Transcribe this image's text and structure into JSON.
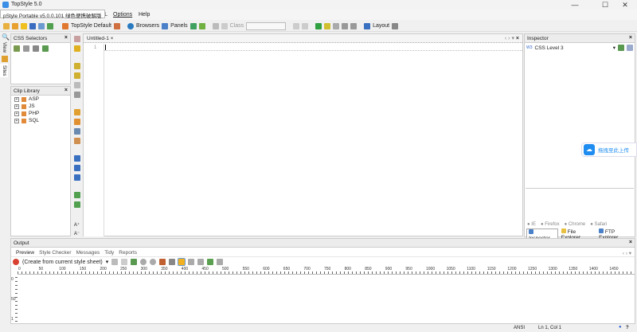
{
  "window": {
    "title": "TopStyle 5.0",
    "tooltip": "pStyle Portable v5.0.0.101 绿色便携破解版",
    "minimize": "—",
    "maximize": "☐",
    "close": "✕"
  },
  "menu": [
    "TML",
    "Options",
    "Help"
  ],
  "toolbar": {
    "style": "TopStyle Default",
    "browsers": "Browsers",
    "panels": "Panels",
    "class_label": "Class",
    "class_value": "",
    "layout": "Layout"
  },
  "left_tabs": [
    "View",
    "Sites"
  ],
  "css_selectors": {
    "title": "CSS Selectors"
  },
  "clip_library": {
    "title": "Clip Library",
    "items": [
      "ASP",
      "JS",
      "PHP",
      "SQL"
    ]
  },
  "editor": {
    "tab": "Untitled-1",
    "line": "1"
  },
  "inspector": {
    "title": "Inspector",
    "level": "CSS Level 3",
    "browsers": [
      "IE",
      "Firefox",
      "Chrome",
      "Safari"
    ],
    "tabs": [
      "Inspector",
      "File Explorer",
      "FTP Explorer"
    ],
    "upload": "拖拽至此上传",
    "upload_color": "#1e8cf0"
  },
  "output": {
    "title": "Output",
    "tabs": [
      "Preview",
      "Style Checker",
      "Messages",
      "Tidy",
      "Reports"
    ],
    "source": "(Create from current style sheet)",
    "ruler": [
      "0",
      "50",
      "100",
      "150",
      "200",
      "250",
      "300",
      "350",
      "400",
      "450",
      "500",
      "550",
      "600",
      "650",
      "700",
      "750",
      "800",
      "850",
      "900",
      "950",
      "1000",
      "1050",
      "1100",
      "1150",
      "1200",
      "1250",
      "1300",
      "1350",
      "1400",
      "1450"
    ],
    "vruler": [
      "0",
      "50",
      "1"
    ]
  },
  "status": {
    "encoding": "ANSI",
    "position": "Ln 1, Col 1",
    "help": "?"
  }
}
